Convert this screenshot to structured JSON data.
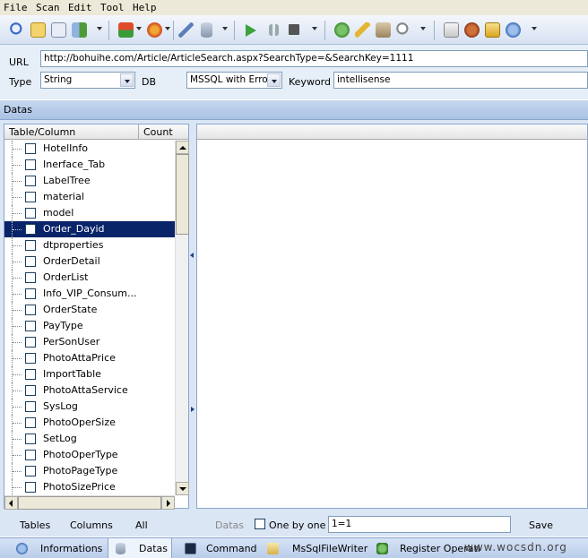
{
  "menu": [
    "File",
    "Scan",
    "Edit",
    "Tool",
    "Help"
  ],
  "toolbar_icons": [
    "search-icon",
    "document-icon",
    "sql-icon",
    "export-icon",
    "dropdown-icon",
    "new-icon",
    "dropdown-icon",
    "palette-icon",
    "dropdown-icon",
    "wrench-icon",
    "database-icon",
    "dropdown-icon",
    "play-icon",
    "pause-icon",
    "stop-icon",
    "dropdown-icon",
    "check-icon",
    "key-icon",
    "tools-icon",
    "magnifier-icon",
    "dropdown-icon",
    "home-icon",
    "user-icon",
    "box-icon",
    "info-icon",
    "dropdown-icon"
  ],
  "form": {
    "url_label": "URL",
    "url_value": "http://bohuihe.com/Article/ArticleSearch.aspx?SearchType=&SearchKey=1111",
    "type_label": "Type",
    "type_value": "String",
    "db_label": "DB",
    "db_value": "MSSQL with Error",
    "keyword_label": "Keyword",
    "keyword_value": "intellisense"
  },
  "datas": {
    "header": "Datas",
    "columns": {
      "table": "Table/Column",
      "count": "Count"
    },
    "rows": [
      "HotelInfo",
      "Inerface_Tab",
      "LabelTree",
      "material",
      "model",
      "Order_Dayid",
      "dtproperties",
      "OrderDetail",
      "OrderList",
      "Info_VIP_Consum...",
      "OrderState",
      "PayType",
      "PerSonUser",
      "PhotoAttaPrice",
      "ImportTable",
      "PhotoAttaService",
      "SysLog",
      "PhotoOperSize",
      "SetLog",
      "PhotoOperType",
      "PhotoPageType",
      "PhotoSizePrice"
    ],
    "selected_index": 5
  },
  "bottom": {
    "tables": "Tables",
    "columns": "Columns",
    "all": "All",
    "datas": "Datas",
    "one_by_one": "One by one",
    "condition": "1=1",
    "save": "Save"
  },
  "status_tabs": [
    {
      "label": "Informations",
      "icon": "info-icon",
      "active": false
    },
    {
      "label": "Datas",
      "icon": "database-icon",
      "active": true
    },
    {
      "label": "Command",
      "icon": "console-icon",
      "active": false
    },
    {
      "label": "MsSqlFileWriter",
      "icon": "file-writer-icon",
      "active": false
    },
    {
      "label": "Register Operati",
      "icon": "register-icon",
      "active": false
    }
  ],
  "watermark": "www.wocsdn.org"
}
